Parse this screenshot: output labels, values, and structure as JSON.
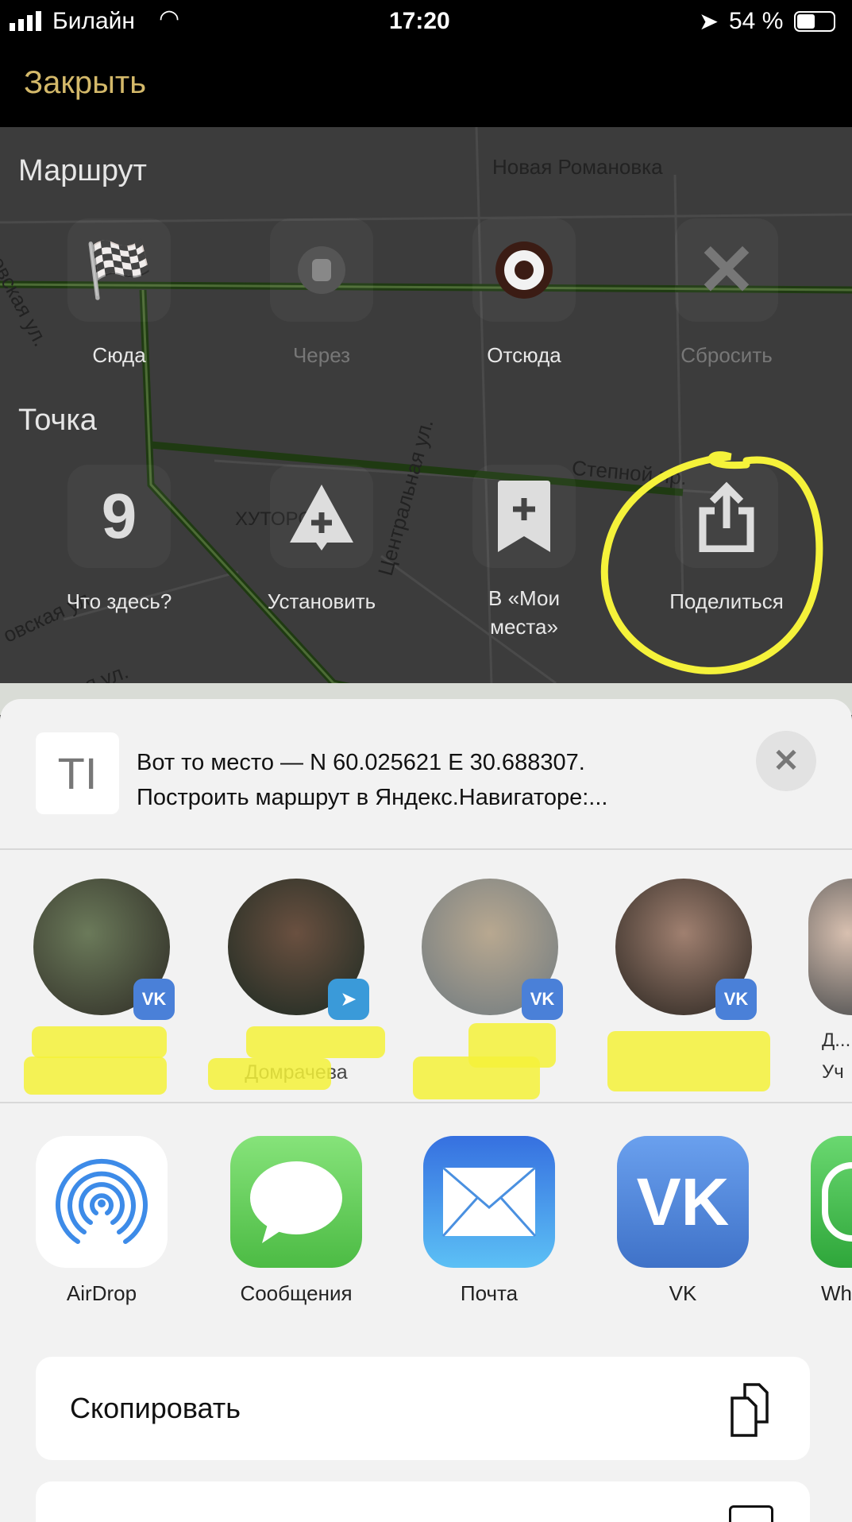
{
  "status": {
    "carrier": "Билайн",
    "time": "17:20",
    "battery": "54 %"
  },
  "header": {
    "close_label": "Закрыть"
  },
  "map": {
    "labels": [
      "Новая Романовка",
      "Центральная ул.",
      "Степной пр.",
      "ХУТОРСКИ",
      "инская ул.",
      "овская ул.",
      "еевская ул."
    ]
  },
  "route": {
    "title": "Маршрут",
    "buttons": [
      {
        "label": "Сюда"
      },
      {
        "label": "Через"
      },
      {
        "label": "Отсюда"
      },
      {
        "label": "Сбросить"
      }
    ]
  },
  "point": {
    "title": "Точка",
    "buttons": [
      {
        "label": "Что здесь?"
      },
      {
        "label": "Установить"
      },
      {
        "label": "В «Мои места»"
      },
      {
        "label": "Поделиться"
      }
    ]
  },
  "share": {
    "preview_line1": "Вот то место — N 60.025621 E 30.688307.",
    "preview_line2": "Построить маршрут в Яндекс.Навигаторе:...",
    "contacts": [
      {
        "name": "",
        "service": "vk"
      },
      {
        "name": "Домрачева",
        "service": "telegram"
      },
      {
        "name": "",
        "service": "vk"
      },
      {
        "name": "",
        "service": "vk"
      },
      {
        "name": "Д... Уч",
        "service": ""
      }
    ],
    "apps": [
      {
        "label": "AirDrop"
      },
      {
        "label": "Сообщения"
      },
      {
        "label": "Почта"
      },
      {
        "label": "VK"
      },
      {
        "label": "Wh"
      }
    ],
    "actions": [
      {
        "label": "Скопировать"
      },
      {
        "label": ""
      }
    ]
  },
  "colors": {
    "accent": "#d4b96a",
    "highlight": "#f5f23a",
    "vk": "#4a80d8",
    "route_green": "#6fa53a"
  }
}
